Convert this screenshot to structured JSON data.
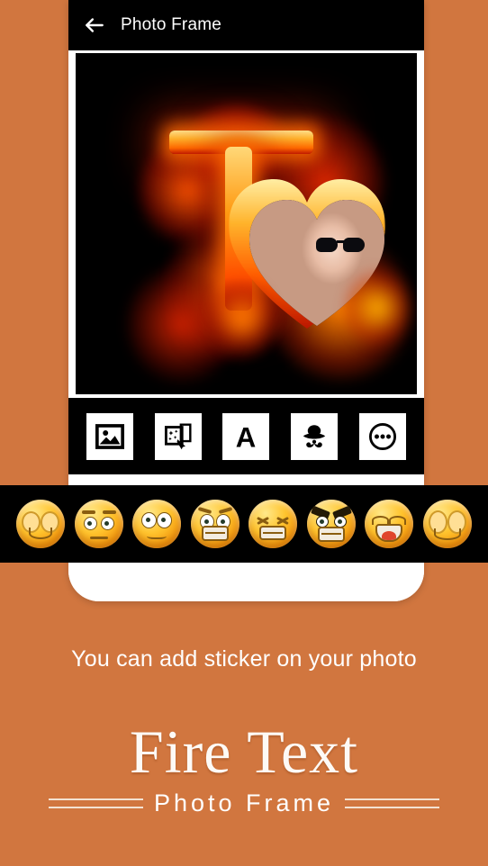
{
  "theme": {
    "background": "#d1763f",
    "panel": "#ffffff",
    "bar": "#000000",
    "text_on_bar": "#ffffff"
  },
  "app_bar": {
    "back_icon": "back-arrow-icon",
    "title": "Photo Frame"
  },
  "editor": {
    "canvas_label": "fire-text-photo-preview",
    "letter": "T",
    "frame_shape": "heart",
    "photo_subject": "woman wearing sunglasses"
  },
  "toolbar": {
    "items": [
      {
        "name": "gallery-button",
        "icon": "image-icon",
        "label": "Gallery"
      },
      {
        "name": "frames-button",
        "icon": "effects-icon",
        "label": "Frames"
      },
      {
        "name": "text-button",
        "icon": "text-a-icon",
        "label": "A"
      },
      {
        "name": "sticker-button",
        "icon": "sticker-hat-mustache-icon",
        "label": "Sticker"
      },
      {
        "name": "more-button",
        "icon": "more-dots-icon",
        "label": "More"
      }
    ]
  },
  "sticker_strip": {
    "stickers": [
      {
        "name": "emoji-sad-tired",
        "label": "Sad tired face"
      },
      {
        "name": "emoji-annoyed",
        "label": "Annoyed face"
      },
      {
        "name": "emoji-worried",
        "label": "Worried face"
      },
      {
        "name": "emoji-frightened",
        "label": "Frightened face"
      },
      {
        "name": "emoji-frustrated",
        "label": "Frustrated face"
      },
      {
        "name": "emoji-angry",
        "label": "Angry face"
      },
      {
        "name": "emoji-laughing-tongue",
        "label": "Laughing face with tongue"
      },
      {
        "name": "emoji-crying-sad",
        "label": "Crying sad face"
      }
    ]
  },
  "tagline": "You can add sticker on your photo",
  "brand": {
    "title": "Fire Text",
    "subtitle": "Photo Frame"
  }
}
